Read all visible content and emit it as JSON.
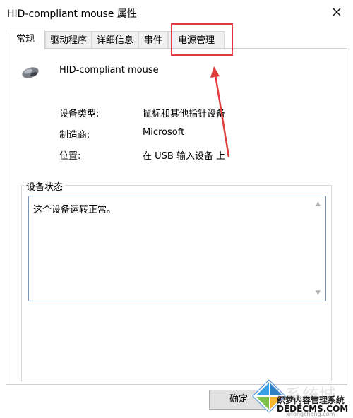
{
  "window": {
    "title": "HID-compliant mouse 属性"
  },
  "tabs": [
    {
      "label": "常规",
      "active": true
    },
    {
      "label": "驱动程序",
      "active": false
    },
    {
      "label": "详细信息",
      "active": false
    },
    {
      "label": "事件",
      "active": false
    },
    {
      "label": "电源管理",
      "active": false
    }
  ],
  "device": {
    "name": "HID-compliant mouse",
    "icon": "mouse-icon"
  },
  "properties": [
    {
      "label": "设备类型:",
      "value": "鼠标和其他指针设备"
    },
    {
      "label": "制造商:",
      "value": "Microsoft"
    },
    {
      "label": "位置:",
      "value": "在 USB 输入设备 上"
    }
  ],
  "status": {
    "group_label": "设备状态",
    "text": "这个设备运转正常。"
  },
  "footer": {
    "ok_label": "确定"
  },
  "watermark": {
    "line1": "系统城",
    "line2": "织梦内容管理系统",
    "line3": "DEDECMS.COM",
    "line4": "xitongcheng.com"
  },
  "colors": {
    "annotation": "#e23b3b",
    "status_border": "#7a96b8"
  }
}
